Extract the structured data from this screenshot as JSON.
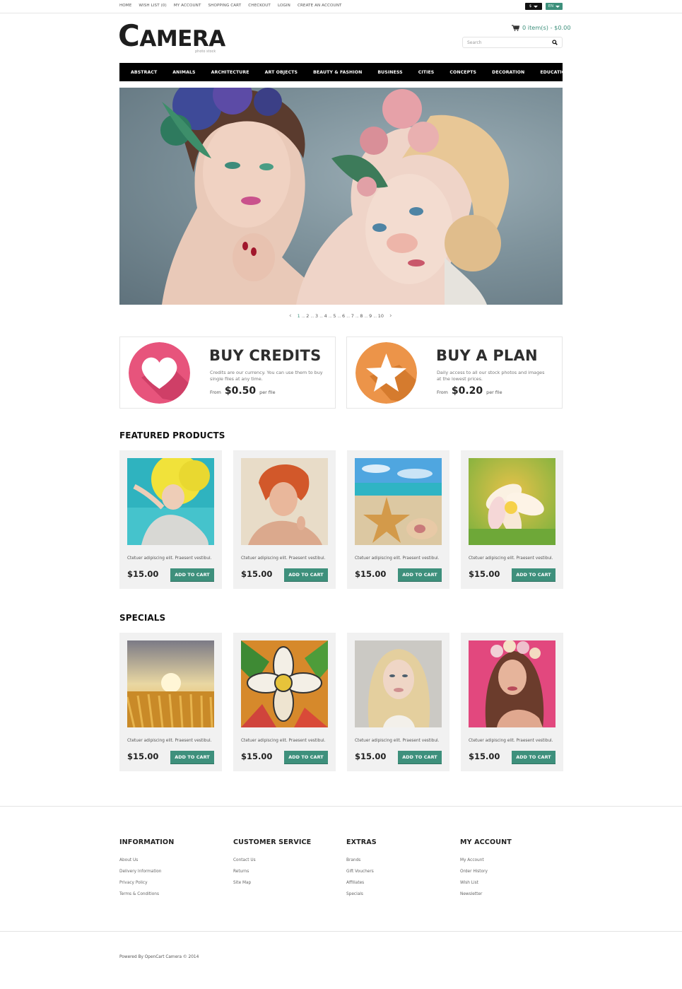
{
  "top_links": [
    "HOME",
    "WISH LIST (0)",
    "MY ACCOUNT",
    "SHOPPING CART",
    "CHECKOUT",
    "LOGIN",
    "CREATE AN ACCOUNT"
  ],
  "currency": {
    "selected": "$"
  },
  "language": {
    "selected": "EN"
  },
  "brand": {
    "first_letter": "C",
    "rest": "AMERA",
    "tagline": "photo stock"
  },
  "cart": {
    "summary": "0 item(s) - $0.00",
    "icon": "cart-icon"
  },
  "search": {
    "placeholder": "Search",
    "value": "",
    "icon": "search-icon"
  },
  "nav": [
    "ABSTRACT",
    "ANIMALS",
    "ARCHITECTURE",
    "ART OBJECTS",
    "BEAUTY & FASHION",
    "BUSINESS",
    "CITIES",
    "CONCEPTS",
    "DECORATION",
    "EDUCATION"
  ],
  "slider": {
    "pages": [
      "1",
      "2",
      "3",
      "4",
      "5",
      "6",
      "7",
      "8",
      "9",
      "10"
    ],
    "active_page": "1",
    "separator": "...",
    "prev_icon": "chevron-left-icon",
    "next_icon": "chevron-right-icon"
  },
  "promos": [
    {
      "title": "BUY CREDITS",
      "desc": "Credits are our currency. You can use them to buy single files at any time.",
      "from": "From",
      "amount": "$0.50",
      "per": "per file",
      "icon": "heart-icon",
      "color": "#e7547c"
    },
    {
      "title": "BUY A PLAN",
      "desc": "Daily access to all our stock photos and images at the lowest prices.",
      "from": "From",
      "amount": "$0.20",
      "per": "per file",
      "icon": "star-icon",
      "color": "#ec9449"
    }
  ],
  "featured": {
    "title": "FEATURED PRODUCTS",
    "products": [
      {
        "desc": "Ctetuer adipiscing elit. Praesent vestibul.",
        "price": "$15.00",
        "button": "ADD TO CART",
        "image": "yellow-hair-woman"
      },
      {
        "desc": "Ctetuer adipiscing elit. Praesent vestibul.",
        "price": "$15.00",
        "button": "ADD TO CART",
        "image": "red-hair-woman"
      },
      {
        "desc": "Ctetuer adipiscing elit. Praesent vestibul.",
        "price": "$15.00",
        "button": "ADD TO CART",
        "image": "starfish-beach"
      },
      {
        "desc": "Ctetuer adipiscing elit. Praesent vestibul.",
        "price": "$15.00",
        "button": "ADD TO CART",
        "image": "plumeria-flower"
      }
    ]
  },
  "specials": {
    "title": "SPECIALS",
    "products": [
      {
        "desc": "Ctetuer adipiscing elit. Praesent vestibul.",
        "price": "$15.00",
        "button": "ADD TO CART",
        "image": "wheat-sunset"
      },
      {
        "desc": "Ctetuer adipiscing elit. Praesent vestibul.",
        "price": "$15.00",
        "button": "ADD TO CART",
        "image": "stained-glass-flower"
      },
      {
        "desc": "Ctetuer adipiscing elit. Praesent vestibul.",
        "price": "$15.00",
        "button": "ADD TO CART",
        "image": "blonde-woman"
      },
      {
        "desc": "Ctetuer adipiscing elit. Praesent vestibul.",
        "price": "$15.00",
        "button": "ADD TO CART",
        "image": "flower-crown-woman"
      }
    ]
  },
  "footer": {
    "columns": [
      {
        "title": "INFORMATION",
        "links": [
          "About Us",
          "Delivery Information",
          "Privacy Policy",
          "Terms & Conditions"
        ]
      },
      {
        "title": "CUSTOMER SERVICE",
        "links": [
          "Contact Us",
          "Returns",
          "Site Map"
        ]
      },
      {
        "title": "EXTRAS",
        "links": [
          "Brands",
          "Gift Vouchers",
          "Affiliates",
          "Specials"
        ]
      },
      {
        "title": "MY ACCOUNT",
        "links": [
          "My Account",
          "Order History",
          "Wish List",
          "Newsletter"
        ]
      }
    ],
    "copyright": "Powered By OpenCart Camera © 2014"
  },
  "colors": {
    "accent": "#3e907c",
    "nav_bg": "#000000",
    "card_bg": "#f1f1f1"
  }
}
